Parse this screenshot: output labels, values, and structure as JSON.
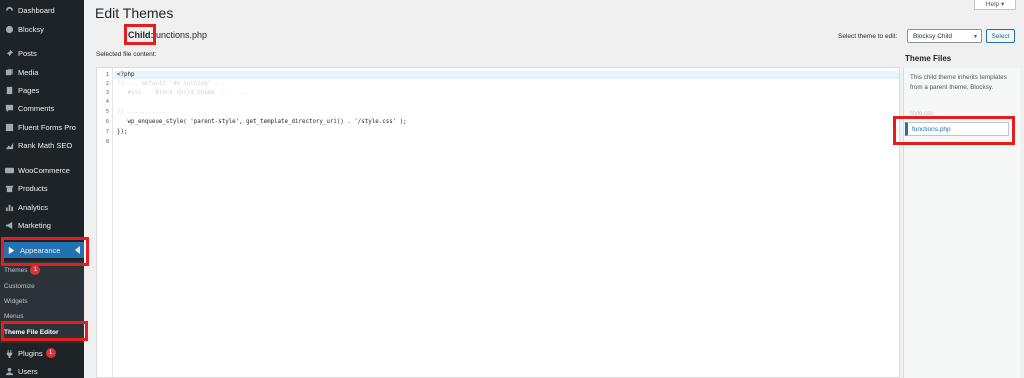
{
  "sidebar": {
    "items": [
      {
        "label": "Dashboard",
        "icon": "dashboard-icon"
      },
      {
        "label": "Blocksy",
        "icon": "blocksy-icon"
      },
      {
        "label": "Posts",
        "icon": "pin-icon"
      },
      {
        "label": "Media",
        "icon": "media-icon"
      },
      {
        "label": "Pages",
        "icon": "page-icon"
      },
      {
        "label": "Comments",
        "icon": "comment-icon"
      },
      {
        "label": "Fluent Forms Pro",
        "icon": "form-icon"
      },
      {
        "label": "Rank Math SEO",
        "icon": "chart-icon"
      },
      {
        "label": "WooCommerce",
        "icon": "woo-icon"
      },
      {
        "label": "Products",
        "icon": "archive-icon"
      },
      {
        "label": "Analytics",
        "icon": "bar-chart-icon"
      },
      {
        "label": "Marketing",
        "icon": "megaphone-icon"
      },
      {
        "label": "Appearance",
        "icon": "brush-icon"
      },
      {
        "label": "Plugins",
        "icon": "plug-icon"
      },
      {
        "label": "Users",
        "icon": "user-icon"
      }
    ],
    "appearance_submenu": [
      {
        "label": "Themes",
        "badge": "1"
      },
      {
        "label": "Customize"
      },
      {
        "label": "Widgets"
      },
      {
        "label": "Menus"
      },
      {
        "label": "Theme File Editor"
      }
    ],
    "plugins_badge": "1"
  },
  "header": {
    "title": "Edit Themes",
    "help_label": "Help ▾"
  },
  "file": {
    "child_label": "Child:",
    "file_name": "functions.php",
    "selected_label": "Selected file content:"
  },
  "theme_select": {
    "label": "Select theme to edit:",
    "value": "Blocksy Child",
    "button": "Select"
  },
  "editor": {
    "lines": [
      {
        "no": "1",
        "code": "<?php"
      },
      {
        "no": "2",
        "code": "// ... default 'do nothing' ..."
      },
      {
        "no": "3",
        "code": "   #ssc   'Block child theme ...   ..."
      },
      {
        "no": "4",
        "code": ""
      },
      {
        "no": "5",
        "code": "// ..........."
      },
      {
        "no": "6",
        "code": "   wp_enqueue_style( 'parent-style', get_template_directory_uri() . '/style.css' );"
      },
      {
        "no": "7",
        "code": "});"
      },
      {
        "no": "8",
        "code": ""
      }
    ]
  },
  "theme_files": {
    "title": "Theme Files",
    "note": "This child theme inherits templates from a parent theme, Blocksy.",
    "files": [
      "style.css",
      "functions.php"
    ]
  },
  "colors": {
    "sidebar_bg": "#1d2327",
    "accent": "#2271b1",
    "highlight_box": "#e41e1e"
  }
}
